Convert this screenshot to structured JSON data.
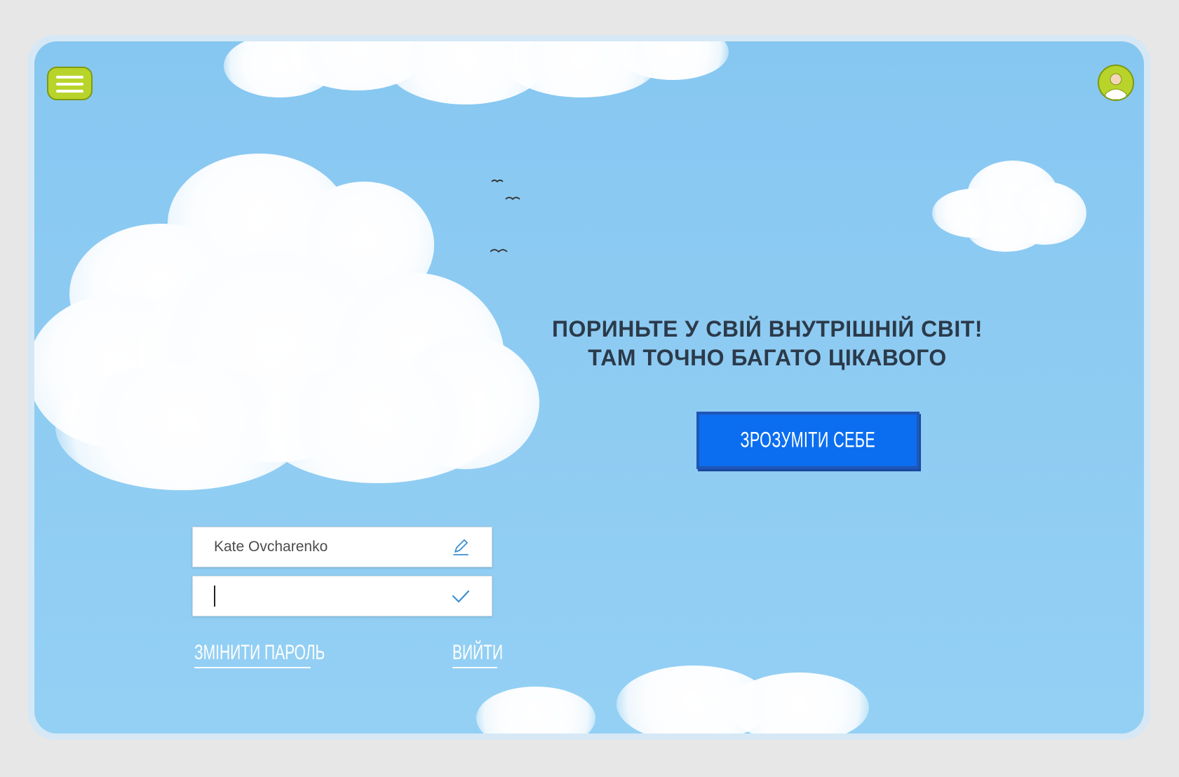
{
  "header": {
    "menu_icon": "hamburger-menu-icon",
    "avatar_icon": "user-avatar-icon"
  },
  "hero": {
    "headline_line1": "ПОРИНЬТЕ У СВІЙ ВНУТРІШНІЙ СВІТ!",
    "headline_line2": "ТАМ ТОЧНО БАГАТО ЦІКАВОГО",
    "cta_label": "ЗРОЗУМІТИ СЕБЕ"
  },
  "profile_form": {
    "name_value": "Kate Ovcharenko",
    "name_icon": "pencil-edit-icon",
    "password_value": "",
    "password_icon": "checkmark-icon",
    "change_password_label": "ЗМІНИТИ ПАРОЛЬ",
    "logout_label": "ВИЙТИ"
  },
  "colors": {
    "sky": "#8ecbf2",
    "accent_green": "#b8d42a",
    "cta_blue": "#0b6ef0",
    "headline_text": "#2b3a4a"
  }
}
